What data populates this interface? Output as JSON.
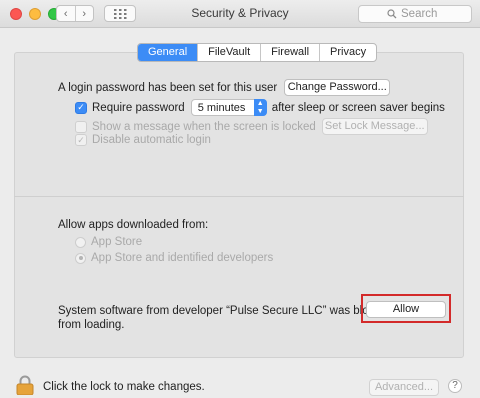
{
  "window": {
    "title": "Security & Privacy",
    "search_placeholder": "Search",
    "back_glyph": "‹",
    "forward_glyph": "›"
  },
  "tabs": [
    {
      "label": "General",
      "active": true
    },
    {
      "label": "FileVault",
      "active": false
    },
    {
      "label": "Firewall",
      "active": false
    },
    {
      "label": "Privacy",
      "active": false
    }
  ],
  "login": {
    "message": "A login password has been set for this user",
    "change_password_label": "Change Password...",
    "require_password_label": "Require password",
    "require_password_checked": true,
    "delay_value": "5 minutes",
    "after_label": "after sleep or screen saver begins",
    "show_message_label": "Show a message when the screen is locked",
    "show_message_checked": false,
    "set_lock_message_label": "Set Lock Message...",
    "disable_auto_login_label": "Disable automatic login",
    "disable_auto_login_checked": true
  },
  "apps": {
    "heading": "Allow apps downloaded from:",
    "options": [
      {
        "label": "App Store",
        "selected": false
      },
      {
        "label": "App Store and identified developers",
        "selected": true
      }
    ]
  },
  "blocked": {
    "line1": "System software from developer “Pulse Secure LLC” was blocked",
    "line2": "from loading.",
    "allow_label": "Allow"
  },
  "footer": {
    "lock_text": "Click the lock to make changes.",
    "advanced_label": "Advanced...",
    "help_label": "?"
  },
  "colors": {
    "accent": "#3c8cf6",
    "highlight": "#d32a2a",
    "lock": "#e6a33a"
  }
}
